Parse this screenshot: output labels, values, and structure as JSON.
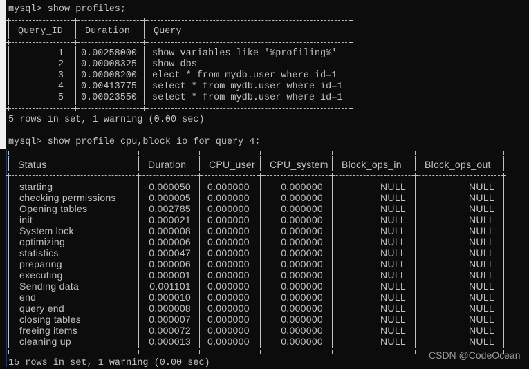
{
  "terminal": {
    "prompt1": "mysql> show profiles;",
    "result1": "5 rows in set, 1 warning (0.00 sec)",
    "prompt2": "mysql> show profile cpu,block io for query 4;",
    "result2": "15 rows in set, 1 warning (0.00 sec)"
  },
  "profiles": {
    "columns": [
      "Query_ID",
      "Duration",
      "Query"
    ],
    "rows": [
      [
        "1",
        "0.00258000",
        "show variables like '%profiling%'"
      ],
      [
        "2",
        "0.00008325",
        "show dbs"
      ],
      [
        "3",
        "0.00008200",
        "elect * from mydb.user where id=1"
      ],
      [
        "4",
        "0.00413775",
        "select * from mydb.user where id=1"
      ],
      [
        "5",
        "0.00023550",
        "select * from mydb.user where id=1"
      ]
    ]
  },
  "profile": {
    "columns": [
      "Status",
      "Duration",
      "CPU_user",
      "CPU_system",
      "Block_ops_in",
      "Block_ops_out"
    ],
    "rows": [
      [
        "starting",
        "0.000050",
        "0.000000",
        "0.000000",
        "NULL",
        "NULL"
      ],
      [
        "checking permissions",
        "0.000005",
        "0.000000",
        "0.000000",
        "NULL",
        "NULL"
      ],
      [
        "Opening tables",
        "0.002785",
        "0.000000",
        "0.000000",
        "NULL",
        "NULL"
      ],
      [
        "init",
        "0.000021",
        "0.000000",
        "0.000000",
        "NULL",
        "NULL"
      ],
      [
        "System lock",
        "0.000008",
        "0.000000",
        "0.000000",
        "NULL",
        "NULL"
      ],
      [
        "optimizing",
        "0.000006",
        "0.000000",
        "0.000000",
        "NULL",
        "NULL"
      ],
      [
        "statistics",
        "0.000047",
        "0.000000",
        "0.000000",
        "NULL",
        "NULL"
      ],
      [
        "preparing",
        "0.000006",
        "0.000000",
        "0.000000",
        "NULL",
        "NULL"
      ],
      [
        "executing",
        "0.000001",
        "0.000000",
        "0.000000",
        "NULL",
        "NULL"
      ],
      [
        "Sending data",
        "0.001101",
        "0.000000",
        "0.000000",
        "NULL",
        "NULL"
      ],
      [
        "end",
        "0.000010",
        "0.000000",
        "0.000000",
        "NULL",
        "NULL"
      ],
      [
        "query end",
        "0.000008",
        "0.000000",
        "0.000000",
        "NULL",
        "NULL"
      ],
      [
        "closing tables",
        "0.000007",
        "0.000000",
        "0.000000",
        "NULL",
        "NULL"
      ],
      [
        "freeing items",
        "0.000072",
        "0.000000",
        "0.000000",
        "NULL",
        "NULL"
      ],
      [
        "cleaning up",
        "0.000013",
        "0.000000",
        "0.000000",
        "NULL",
        "NULL"
      ]
    ]
  },
  "watermark": "CSDN @CodeOcean",
  "colors": {
    "background": "#0c0c0c",
    "text": "#c0c0c0"
  }
}
